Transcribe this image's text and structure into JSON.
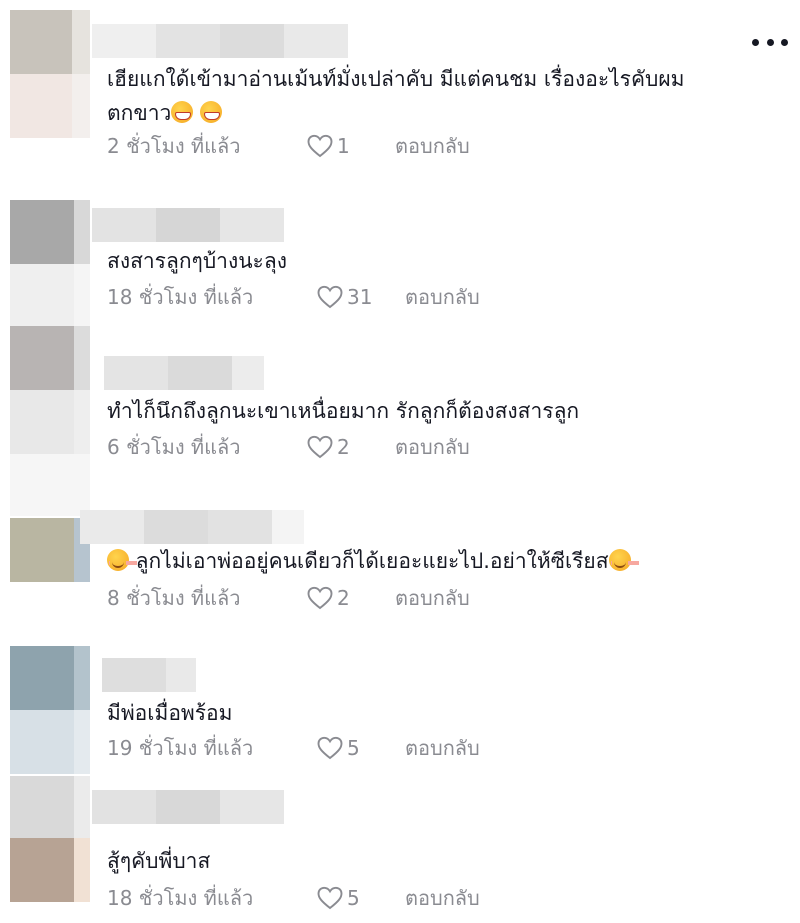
{
  "more_icon": "more-horizontal-icon",
  "like_icon": "heart-outline-icon",
  "comments": [
    {
      "text": "เฮียแกใด้เข้ามาอ่านเม้นท์มั่งเปล่าคับ มีแต่คนชม เรื่องอะไรคับผม",
      "text2": "ตกขาว",
      "time": "2 ชั่วโมง ที่แล้ว",
      "likes": "1",
      "reply": "ตอบกลับ"
    },
    {
      "text": "สงสารลูกๆบ้างนะลุง",
      "time": "18 ชั่วโมง ที่แล้ว",
      "likes": "31",
      "reply": "ตอบกลับ"
    },
    {
      "text": "ทำไก็นึกถึงลูกนะเขาเหนื่อยมาก รักลูกก็ต้องสงสารลูก",
      "time": "6 ชั่วโมง ที่แล้ว",
      "likes": "2",
      "reply": "ตอบกลับ"
    },
    {
      "text": " ลูกไม่เอาพ่ออยู่คนเดียวก็ได้เยอะแยะไป.อย่าให้ซีเรียส",
      "time": "8 ชั่วโมง ที่แล้ว",
      "likes": "2",
      "reply": "ตอบกลับ"
    },
    {
      "text": "มีพ่อเมื่อพร้อม",
      "time": "19 ชั่วโมง ที่แล้ว",
      "likes": "5",
      "reply": "ตอบกลับ"
    },
    {
      "text": "สู้ๆคับพี่บาส",
      "time": "18 ชั่วโมง ที่แล้ว",
      "likes": "5",
      "reply": "ตอบกลับ"
    }
  ]
}
